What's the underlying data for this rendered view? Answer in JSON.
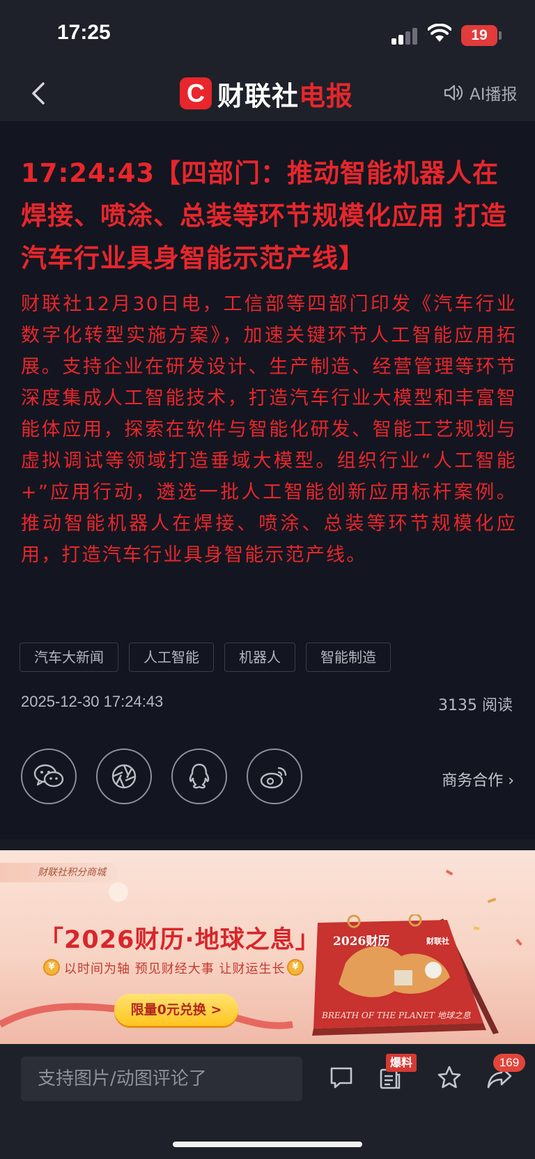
{
  "status_bar": {
    "time": "17:25",
    "battery": "19"
  },
  "nav": {
    "logo_mark": "C",
    "logo_text": "财联社",
    "logo_text_red": "电报",
    "ai_label": "AI播报"
  },
  "article": {
    "headline": "17:24:43【四部门：推动智能机器人在焊接、喷涂、总装等环节规模化应用 打造汽车行业具身智能示范产线】",
    "body": "财联社12月30日电，工信部等四部门印发《汽车行业数字化转型实施方案》，加速关键环节人工智能应用拓展。支持企业在研发设计、生产制造、经营管理等环节深度集成人工智能技术，打造汽车行业大模型和丰富智能体应用，探索在软件与智能化研发、智能工艺规划与虚拟调试等领域打造垂域大模型。组织行业“人工智能+”应用行动，遴选一批人工智能创新应用标杆案例。推动智能机器人在焊接、喷涂、总装等环节规模化应用，打造汽车行业具身智能示范产线。",
    "tags": [
      "汽车大新闻",
      "人工智能",
      "机器人",
      "智能制造"
    ],
    "date": "2025-12-30 17:24:43",
    "reads": "3135 阅读",
    "business": "商务合作 ›"
  },
  "banner": {
    "tag": "财联社积分商城",
    "title": "「2026财历·地球之息」来了",
    "subtitle": "以时间为轴  预见财经大事  让财运生长",
    "cta": "限量0元兑换 >",
    "calendar_title": "2026财历",
    "calendar_brand": "财联社",
    "calendar_caption": "BREATH OF THE PLANET 地球之息"
  },
  "bottom_bar": {
    "comment_placeholder": "支持图片/动图评论了",
    "report_badge": "爆料",
    "share_count": "169"
  },
  "colors": {
    "accent": "#e8262c",
    "background": "#131620",
    "bar": "#1e2129"
  }
}
